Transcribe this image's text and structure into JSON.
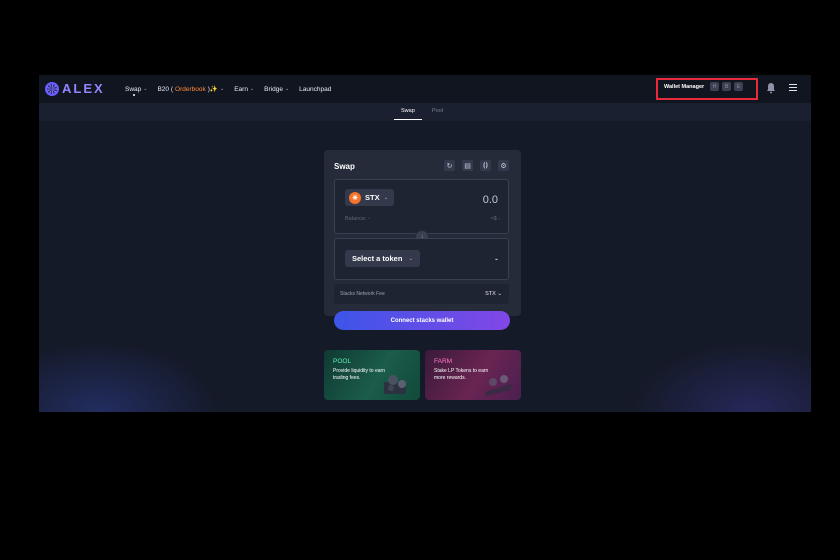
{
  "logo": {
    "text": "ALEX"
  },
  "nav": {
    "items": [
      {
        "label": "Swap",
        "has_dropdown": true
      },
      {
        "label_prefix": "B20 (",
        "label_highlight": "Orderbook",
        "label_suffix": ")✨",
        "has_dropdown": true
      },
      {
        "label": "Earn",
        "has_dropdown": true
      },
      {
        "label": "Bridge",
        "has_dropdown": true
      },
      {
        "label": "Launchpad",
        "has_dropdown": false
      }
    ],
    "wallet_manager": {
      "label": "Wallet Manager",
      "chips": [
        "H",
        "B",
        "E"
      ]
    },
    "icons": {
      "notifications": "bell-icon",
      "menu": "hamburger-menu-icon"
    }
  },
  "subnav": {
    "tabs": [
      {
        "label": "Swap",
        "active": true
      },
      {
        "label": "Pool",
        "active": false
      }
    ]
  },
  "swap_card": {
    "title": "Swap",
    "tools": [
      "refresh-icon",
      "table-icon",
      "broadcast-icon",
      "settings-icon"
    ],
    "from": {
      "token": "STX",
      "token_icon": "stx-icon",
      "amount": "0.0",
      "balance": "Balance: -",
      "usd": "≈$ -"
    },
    "to": {
      "select_label": "Select a token",
      "amount": "-"
    },
    "fee": {
      "label": "Stacks Network Fee",
      "token": "STX"
    },
    "connect_button": "Connect stacks wallet"
  },
  "promos": [
    {
      "title": "POOL",
      "desc": "Provide liquidity to earn trading fees."
    },
    {
      "title": "FARM",
      "desc": "Stake LP Tokens to earn more rewards."
    }
  ],
  "colors": {
    "background": "#151a29",
    "nav": "#11151f",
    "card": "#262b3a",
    "accent_orange": "#ff8a3c",
    "highlight_border": "#e82a3a",
    "button_gradient_start": "#3d55e8",
    "button_gradient_end": "#8247e6"
  }
}
